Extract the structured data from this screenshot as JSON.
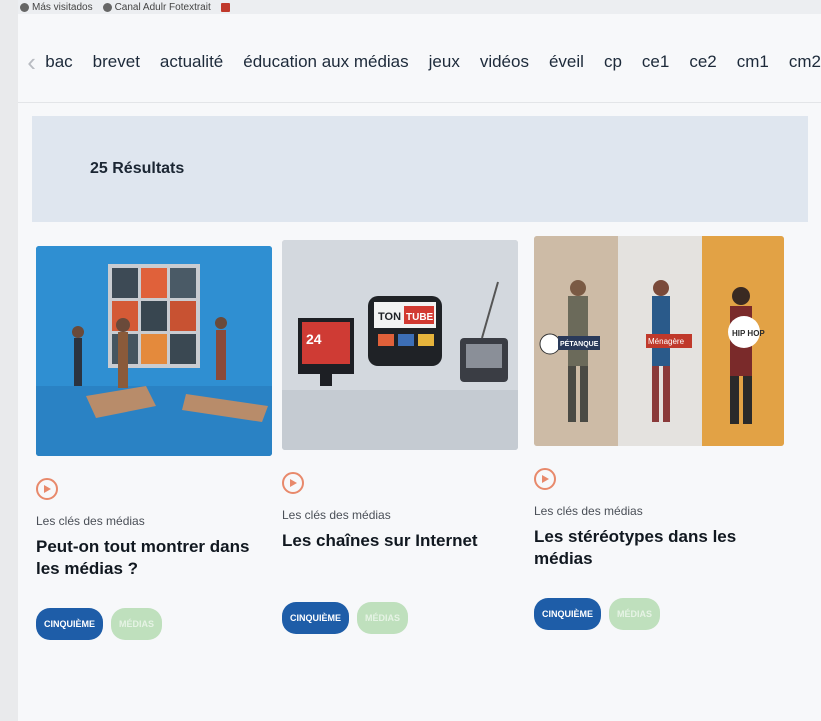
{
  "bookmarks": [
    {
      "label": "Más visitados",
      "icon": "gear-icon"
    },
    {
      "label": "Canal Adulr Fotextrait",
      "icon": "folder-icon"
    }
  ],
  "nav": {
    "items": [
      "bac",
      "brevet",
      "actualité",
      "éducation aux médias",
      "jeux",
      "vidéos",
      "éveil",
      "cp",
      "ce1",
      "ce2",
      "cm1",
      "cm2"
    ]
  },
  "results": {
    "label": "25 Résultats"
  },
  "cards": [
    {
      "series": "Les clés des médias",
      "title": "Peut-on tout montrer dans les médias ?",
      "tags": [
        "CINQUIÈME",
        "MÉDIAS"
      ]
    },
    {
      "series": "Les clés des médias",
      "title": "Les chaînes sur Internet",
      "tags": [
        "CINQUIÈME",
        "MÉDIAS"
      ],
      "thumb_text": {
        "tv": "24",
        "sign_top": "TON",
        "sign_box": "TUBE"
      }
    },
    {
      "series": "Les clés des médias",
      "title": "Les stéréotypes dans les médias",
      "tags": [
        "CINQUIÈME",
        "MÉDIAS"
      ],
      "thumb_text": {
        "label1": "PÉTANQUE",
        "label2": "Ménagère",
        "label3": "HIP HOP"
      }
    }
  ],
  "colors": {
    "accent_play": "#e8896b",
    "tag_blue": "#1e5da8",
    "tag_green": "#bfe0bd",
    "banner": "#dfe6ef"
  }
}
